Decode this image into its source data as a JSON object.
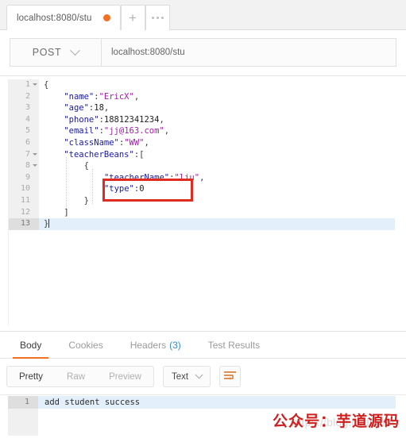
{
  "tabbar": {
    "request_tab_label": "localhost:8080/stu",
    "unsaved_indicator": "unsaved-dot",
    "new_tab_label": "+",
    "more_label": "..."
  },
  "request": {
    "method": "POST",
    "url": "localhost:8080/stu"
  },
  "body_editor": {
    "lines": [
      {
        "num": "1",
        "fold": true,
        "text": "{",
        "caret": false
      },
      {
        "num": "2",
        "fold": false,
        "text": "    \"name\":\"EricX\",",
        "caret": false
      },
      {
        "num": "3",
        "fold": false,
        "text": "    \"age\":18,",
        "caret": false
      },
      {
        "num": "4",
        "fold": false,
        "text": "    \"phone\":18812341234,",
        "caret": false
      },
      {
        "num": "5",
        "fold": false,
        "text": "    \"email\":\"jj@163.com\",",
        "caret": false
      },
      {
        "num": "6",
        "fold": false,
        "text": "    \"className\":\"WW\",",
        "caret": false
      },
      {
        "num": "7",
        "fold": true,
        "text": "    \"teacherBeans\":[",
        "caret": false
      },
      {
        "num": "8",
        "fold": true,
        "text": "        {",
        "caret": false
      },
      {
        "num": "9",
        "fold": false,
        "text": "            \"teacherName\":\"liu\",",
        "caret": false
      },
      {
        "num": "10",
        "fold": false,
        "text": "            \"type\":0",
        "caret": false
      },
      {
        "num": "11",
        "fold": false,
        "text": "        }",
        "caret": false
      },
      {
        "num": "12",
        "fold": false,
        "text": "    ]",
        "caret": false
      },
      {
        "num": "13",
        "fold": false,
        "text": "}",
        "caret": true
      }
    ],
    "highlight_note": "red annotation box around line 10 \"type\":0",
    "active_line": "13"
  },
  "response_tabs": [
    {
      "label": "Body",
      "active": true,
      "count": ""
    },
    {
      "label": "Cookies",
      "active": false,
      "count": ""
    },
    {
      "label": "Headers",
      "active": false,
      "count": "(3)"
    },
    {
      "label": "Test Results",
      "active": false,
      "count": ""
    }
  ],
  "response_toolbar": {
    "view_modes": [
      {
        "label": "Pretty",
        "active": true
      },
      {
        "label": "Raw",
        "active": false
      },
      {
        "label": "Preview",
        "active": false
      }
    ],
    "format_selected": "Text",
    "wrap_icon": "word-wrap-icon"
  },
  "response_body": {
    "line_number": "1",
    "text": "add student success"
  },
  "watermarks": {
    "url": "https://blog.csdn.net",
    "red_text": "公众号：芋道源码"
  },
  "colors": {
    "accent_orange": "#f37022",
    "annotation_red": "#e02b20",
    "json_key": "#1a1aa6",
    "json_string": "#a31caa",
    "link_blue": "#3a8bc9",
    "watermark_red": "#cf2020"
  }
}
